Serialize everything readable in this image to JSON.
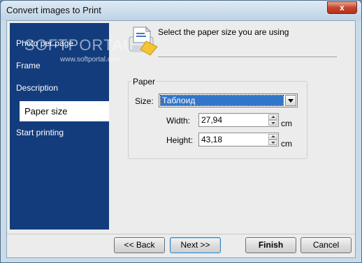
{
  "window": {
    "title": "Convert images to Print",
    "close_glyph": "x"
  },
  "watermark": {
    "text": "SOFTPORTAL",
    "url": "www.softportal.com"
  },
  "sidebar": {
    "items": [
      {
        "label": "Photo per page",
        "active": false
      },
      {
        "label": "Frame",
        "active": false
      },
      {
        "label": "Description",
        "active": false
      },
      {
        "label": "Paper size",
        "active": true
      },
      {
        "label": "Start printing",
        "active": false
      }
    ]
  },
  "header": {
    "text": "Select the paper size you are using",
    "icon": "printer-paper-icon"
  },
  "paper_group": {
    "title": "Paper",
    "size_label": "Size:",
    "size_value": "Таблоид",
    "width_label": "Width:",
    "width_value": "27,94",
    "width_unit": "cm",
    "height_label": "Height:",
    "height_value": "43,18",
    "height_unit": "cm"
  },
  "buttons": {
    "back": "<< Back",
    "next": "Next >>",
    "finish": "Finish",
    "cancel": "Cancel"
  },
  "colors": {
    "sidebar": "#133c7c",
    "selection": "#3176c8"
  }
}
